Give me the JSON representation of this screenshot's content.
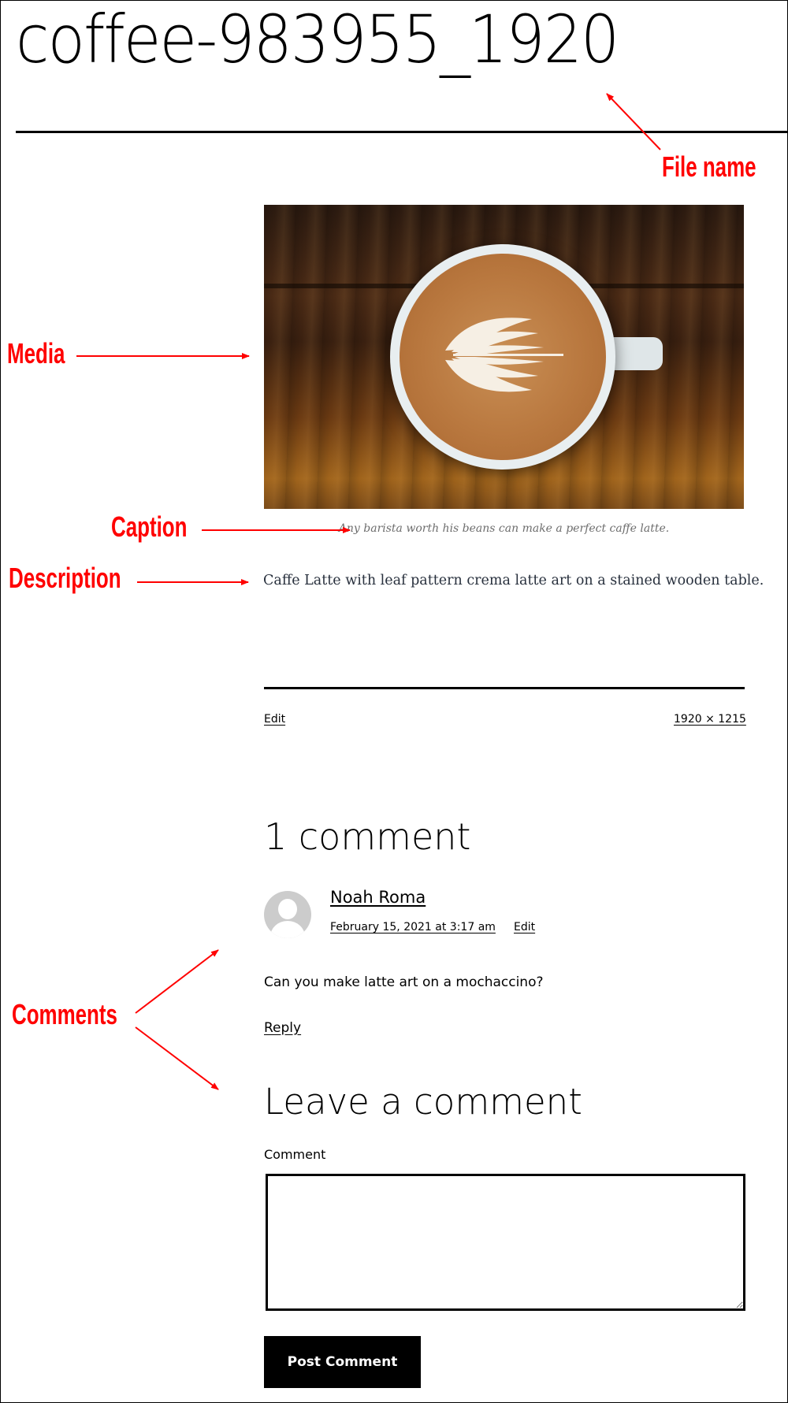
{
  "page": {
    "title": "coffee-983955_1920"
  },
  "attachment": {
    "media_alt": "Caffe latte with leaf pattern latte art in a white cup on a wooden table",
    "caption": "Any barista worth his beans can make a perfect caffe latte.",
    "description": "Caffe Latte with leaf pattern crema latte art on a stained wooden table.",
    "edit_label": "Edit",
    "dimensions_label": "1920 × 1215"
  },
  "comments": {
    "title": "1 comment",
    "items": [
      {
        "author": "Noah Roma",
        "date": "February 15, 2021 at 3:17 am",
        "edit_label": "Edit",
        "text": "Can you make latte art on a mochaccino?",
        "reply_label": "Reply"
      }
    ]
  },
  "comment_form": {
    "title": "Leave a comment",
    "comment_label": "Comment",
    "comment_value": "",
    "submit_label": "Post Comment"
  },
  "annotations": {
    "file_name": "File name",
    "media": "Media",
    "caption": "Caption",
    "description": "Description",
    "comments": "Comments",
    "color": "#ff0000"
  }
}
